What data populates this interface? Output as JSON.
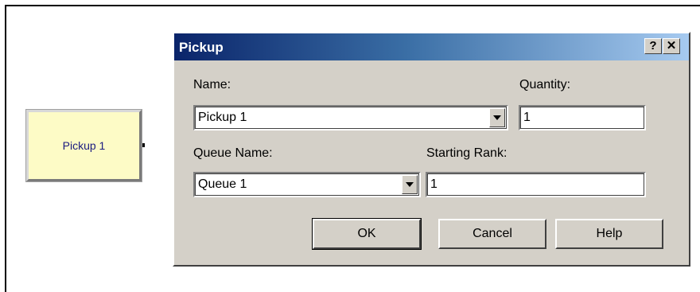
{
  "canvas": {
    "module_label": "Pickup 1"
  },
  "dialog": {
    "title": "Pickup",
    "help_label": "?",
    "close_label": "✕",
    "name_label": "Name:",
    "name_value": "Pickup 1",
    "quantity_label": "Quantity:",
    "quantity_value": "1",
    "queue_name_label": "Queue Name:",
    "queue_name_value": "Queue 1",
    "starting_rank_label": "Starting Rank:",
    "starting_rank_value": "1",
    "ok_label": "OK",
    "cancel_label": "Cancel",
    "help_button_label": "Help"
  }
}
